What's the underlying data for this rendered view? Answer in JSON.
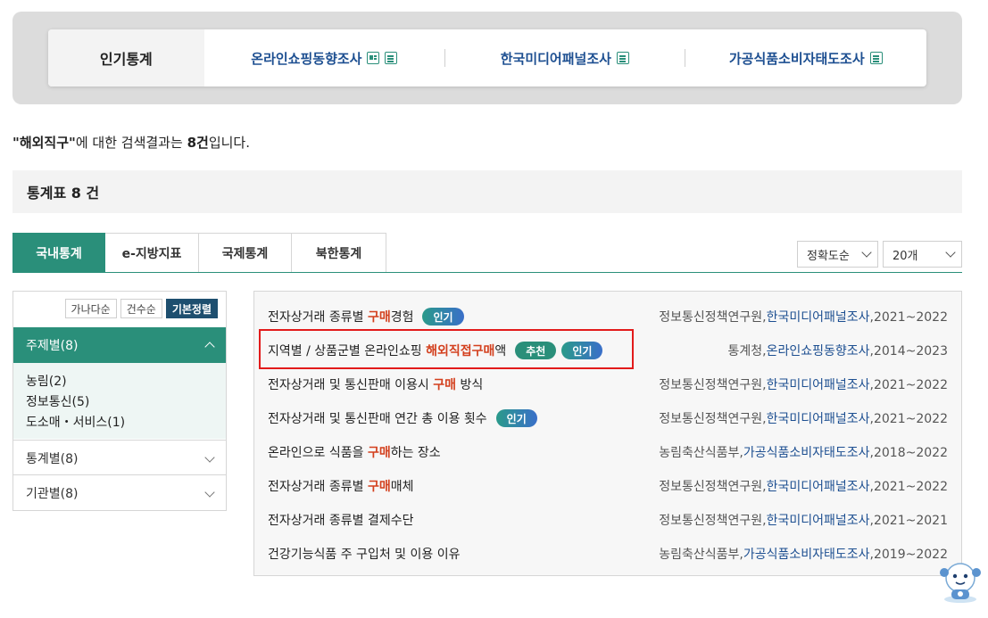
{
  "popular": {
    "title": "인기통계",
    "links": [
      {
        "label": "온라인쇼핑동향조사",
        "icons": [
          "card-icon",
          "doc-icon"
        ]
      },
      {
        "label": "한국미디어패널조사",
        "icons": [
          "doc-icon"
        ]
      },
      {
        "label": "가공식품소비자태도조사",
        "icons": [
          "doc-icon"
        ]
      }
    ]
  },
  "result": {
    "query": "\"해외직구\"",
    "mid": "에 대한 검색결과는 ",
    "count": "8건",
    "tail": "입니다."
  },
  "section": {
    "title": "통계표 8 건"
  },
  "tabs": [
    "국내통계",
    "e-지방지표",
    "국제통계",
    "북한통계"
  ],
  "sort": {
    "order": "정확도순",
    "per_page": "20개"
  },
  "filter": {
    "sort_buttons": [
      "가나다순",
      "건수순",
      "기본정렬"
    ],
    "groups": [
      {
        "label": "주제별(8)",
        "open": true,
        "items": [
          "농림(2)",
          "정보통신(5)",
          "도소매・서비스(1)"
        ]
      },
      {
        "label": "통계별(8)",
        "open": false
      },
      {
        "label": "기관별(8)",
        "open": false
      }
    ]
  },
  "rows": [
    {
      "pre": "전자상거래 종류별 ",
      "hl": "구매",
      "post": "경험",
      "badges": [
        "인기"
      ],
      "org": "정보통신정책연구원,",
      "src": "한국미디어패널조사",
      "period": ",2021~2022"
    },
    {
      "pre": "지역별 / 상품군별 온라인쇼핑 ",
      "hl": "해외직접구매",
      "post": "액",
      "badges": [
        "추천",
        "인기"
      ],
      "org": "통계청,",
      "src": "온라인쇼핑동향조사",
      "period": ",2014~2023"
    },
    {
      "pre": "전자상거래 및 통신판매 이용시 ",
      "hl": "구매",
      "post": " 방식",
      "badges": [],
      "org": "정보통신정책연구원,",
      "src": "한국미디어패널조사",
      "period": ",2021~2022"
    },
    {
      "pre": "전자상거래 및 통신판매 연간 총 이용 횟수",
      "hl": "",
      "post": "",
      "badges": [
        "인기"
      ],
      "org": "정보통신정책연구원,",
      "src": "한국미디어패널조사",
      "period": ",2021~2022"
    },
    {
      "pre": "온라인으로 식품을 ",
      "hl": "구매",
      "post": "하는 장소",
      "badges": [],
      "org": "농림축산식품부,",
      "src": "가공식품소비자태도조사",
      "period": ",2018~2022"
    },
    {
      "pre": "전자상거래 종류별 ",
      "hl": "구매",
      "post": "매체",
      "badges": [],
      "org": "정보통신정책연구원,",
      "src": "한국미디어패널조사",
      "period": ",2021~2022"
    },
    {
      "pre": "전자상거래 종류별 결제수단",
      "hl": "",
      "post": "",
      "badges": [],
      "org": "정보통신정책연구원,",
      "src": "한국미디어패널조사",
      "period": ",2021~2021"
    },
    {
      "pre": "건강기능식품 주 구입처 및 이용 이유",
      "hl": "",
      "post": "",
      "badges": [],
      "org": "농림축산식품부,",
      "src": "가공식품소비자태도조사",
      "period": ",2019~2022"
    }
  ],
  "colors": {
    "accent": "#2a8f7a",
    "highlight": "#d3401e",
    "link": "#1d4f91",
    "selection_box": "#e21b1b"
  }
}
